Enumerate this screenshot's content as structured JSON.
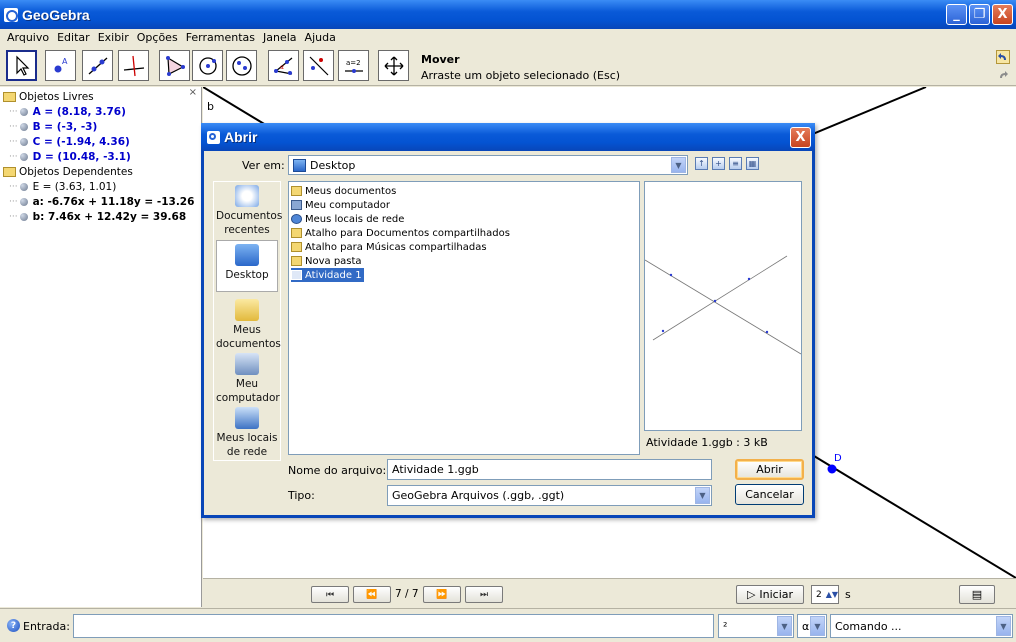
{
  "window": {
    "title": "GeoGebra",
    "minimize": "_",
    "maximize": "❐",
    "close": "X"
  },
  "menu": [
    "Arquivo",
    "Editar",
    "Exibir",
    "Opções",
    "Ferramentas",
    "Janela",
    "Ajuda"
  ],
  "toolbar": {
    "tool_name": "Mover",
    "tool_help": "Arraste um objeto selecionado (Esc)",
    "tools": [
      "move-tool",
      "point-tool",
      "line-tool",
      "perpendicular-tool",
      "polygon-tool",
      "circle-tool",
      "conic-tool",
      "angle-tool",
      "reflect-tool",
      "slider-tool",
      "move-view-tool"
    ]
  },
  "algebra": {
    "close": "×",
    "free_header": "Objetos Livres",
    "free": [
      "A = (8.18, 3.76)",
      "B = (-3, -3)",
      "C = (-1.94, 4.36)",
      "D = (10.48, -3.1)"
    ],
    "dep_header": "Objetos Dependentes",
    "dependent": [
      "E = (3.63, 1.01)",
      "a: -6.76x + 11.18y = -13.26",
      "b: 7.46x + 12.42y = 39.68"
    ]
  },
  "graphics": {
    "label_b": "b",
    "label_D": "D"
  },
  "navbar": {
    "first": "⏮",
    "prev": "⏪",
    "count": "7 / 7",
    "next": "⏩",
    "last": "⏭",
    "play_label": "Iniciar",
    "speed": "2",
    "speed_unit": "s",
    "table": "▤"
  },
  "inputbar": {
    "label": "Entrada:",
    "symbol1": "²",
    "symbol2": "α",
    "command_placeholder": "Comando ..."
  },
  "dialog": {
    "title": "Abrir",
    "close": "X",
    "lookin_label": "Ver em:",
    "lookin_value": "Desktop",
    "places": [
      "Documentos recentes",
      "Desktop",
      "Meus documentos",
      "Meu computador",
      "Meus locais de rede"
    ],
    "files": [
      "Meus documentos",
      "Meu computador",
      "Meus locais de rede",
      "Atalho para Documentos compartilhados",
      "Atalho para Músicas compartilhadas",
      "Nova pasta",
      "Atividade 1"
    ],
    "preview_caption": "Atividade 1.ggb : 3 kB",
    "filename_label": "Nome do arquivo:",
    "filename_value": "Atividade 1.ggb",
    "type_label": "Tipo:",
    "type_value": "GeoGebra Arquivos (.ggb, .ggt)",
    "open_button": "Abrir",
    "cancel_button": "Cancelar"
  },
  "colors": {
    "titlebar": "#0453d2",
    "free_objects": "#0000cc",
    "selection": "#316ac5",
    "point": "#0000ff"
  }
}
